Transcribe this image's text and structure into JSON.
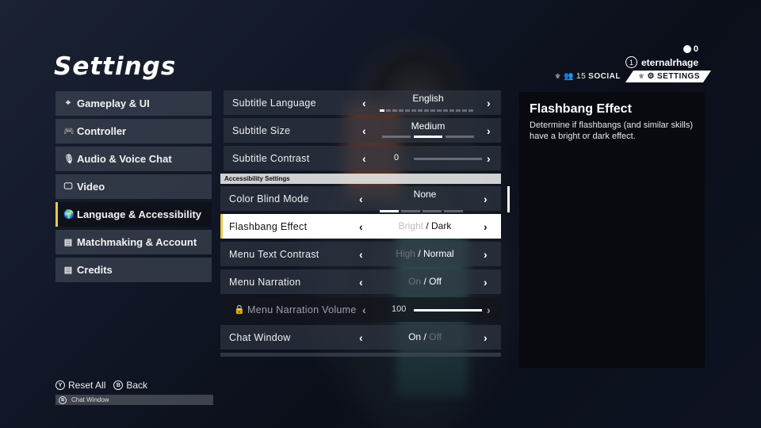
{
  "title": "Settings",
  "header": {
    "currency_value": "0",
    "player_level": "1",
    "username": "eternalrhage",
    "social_count": "15",
    "social_label": "SOCIAL",
    "settings_label": "SETTINGS"
  },
  "sidebar": {
    "items": [
      {
        "label": "Gameplay & UI",
        "icon": "crosshair-icon",
        "active": false
      },
      {
        "label": "Controller",
        "icon": "gamepad-icon",
        "active": false
      },
      {
        "label": "Audio & Voice Chat",
        "icon": "microphone-icon",
        "active": false
      },
      {
        "label": "Video",
        "icon": "monitor-icon",
        "active": false
      },
      {
        "label": "Language & Accessibility",
        "icon": "globe-icon",
        "active": true
      },
      {
        "label": "Matchmaking & Account",
        "icon": "list-icon",
        "active": false
      },
      {
        "label": "Credits",
        "icon": "list-icon",
        "active": false
      }
    ]
  },
  "settings": {
    "subtitle_language": {
      "label": "Subtitle Language",
      "value": "English",
      "option_index": 1,
      "option_count": 15
    },
    "subtitle_size": {
      "label": "Subtitle Size",
      "value": "Medium",
      "option_index": 2,
      "option_count": 3
    },
    "subtitle_contrast": {
      "label": "Subtitle Contrast",
      "value": "0",
      "slider_percent": 0
    },
    "section_header": "Accessibility Settings",
    "color_blind_mode": {
      "label": "Color Blind Mode",
      "value": "None",
      "option_index": 1,
      "option_count": 4
    },
    "flashbang_effect": {
      "label": "Flashbang Effect",
      "option_a": "Bright",
      "option_b": "Dark",
      "selected": "Dark"
    },
    "menu_text_contrast": {
      "label": "Menu Text Contrast",
      "option_a": "High",
      "option_b": "Normal",
      "selected": "Normal"
    },
    "menu_narration": {
      "label": "Menu Narration",
      "option_a": "On",
      "option_b": "Off",
      "selected": "Off"
    },
    "menu_narration_volume": {
      "label": "Menu Narration Volume",
      "value": "100",
      "slider_percent": 100,
      "locked": true
    },
    "chat_window": {
      "label": "Chat Window",
      "option_a": "On",
      "option_b": "Off",
      "selected": "On"
    },
    "separator": "/"
  },
  "description": {
    "title": "Flashbang Effect",
    "text": "Determine if flashbangs (and similar skills) have a bright or dark effect."
  },
  "footer": {
    "reset_button_key": "Y",
    "reset_label": "Reset All",
    "back_button_key": "B",
    "back_label": "Back",
    "chat_window_label": "Chat Window"
  },
  "colors": {
    "accent": "#e9c84a",
    "selected_row": "#ffffff"
  }
}
